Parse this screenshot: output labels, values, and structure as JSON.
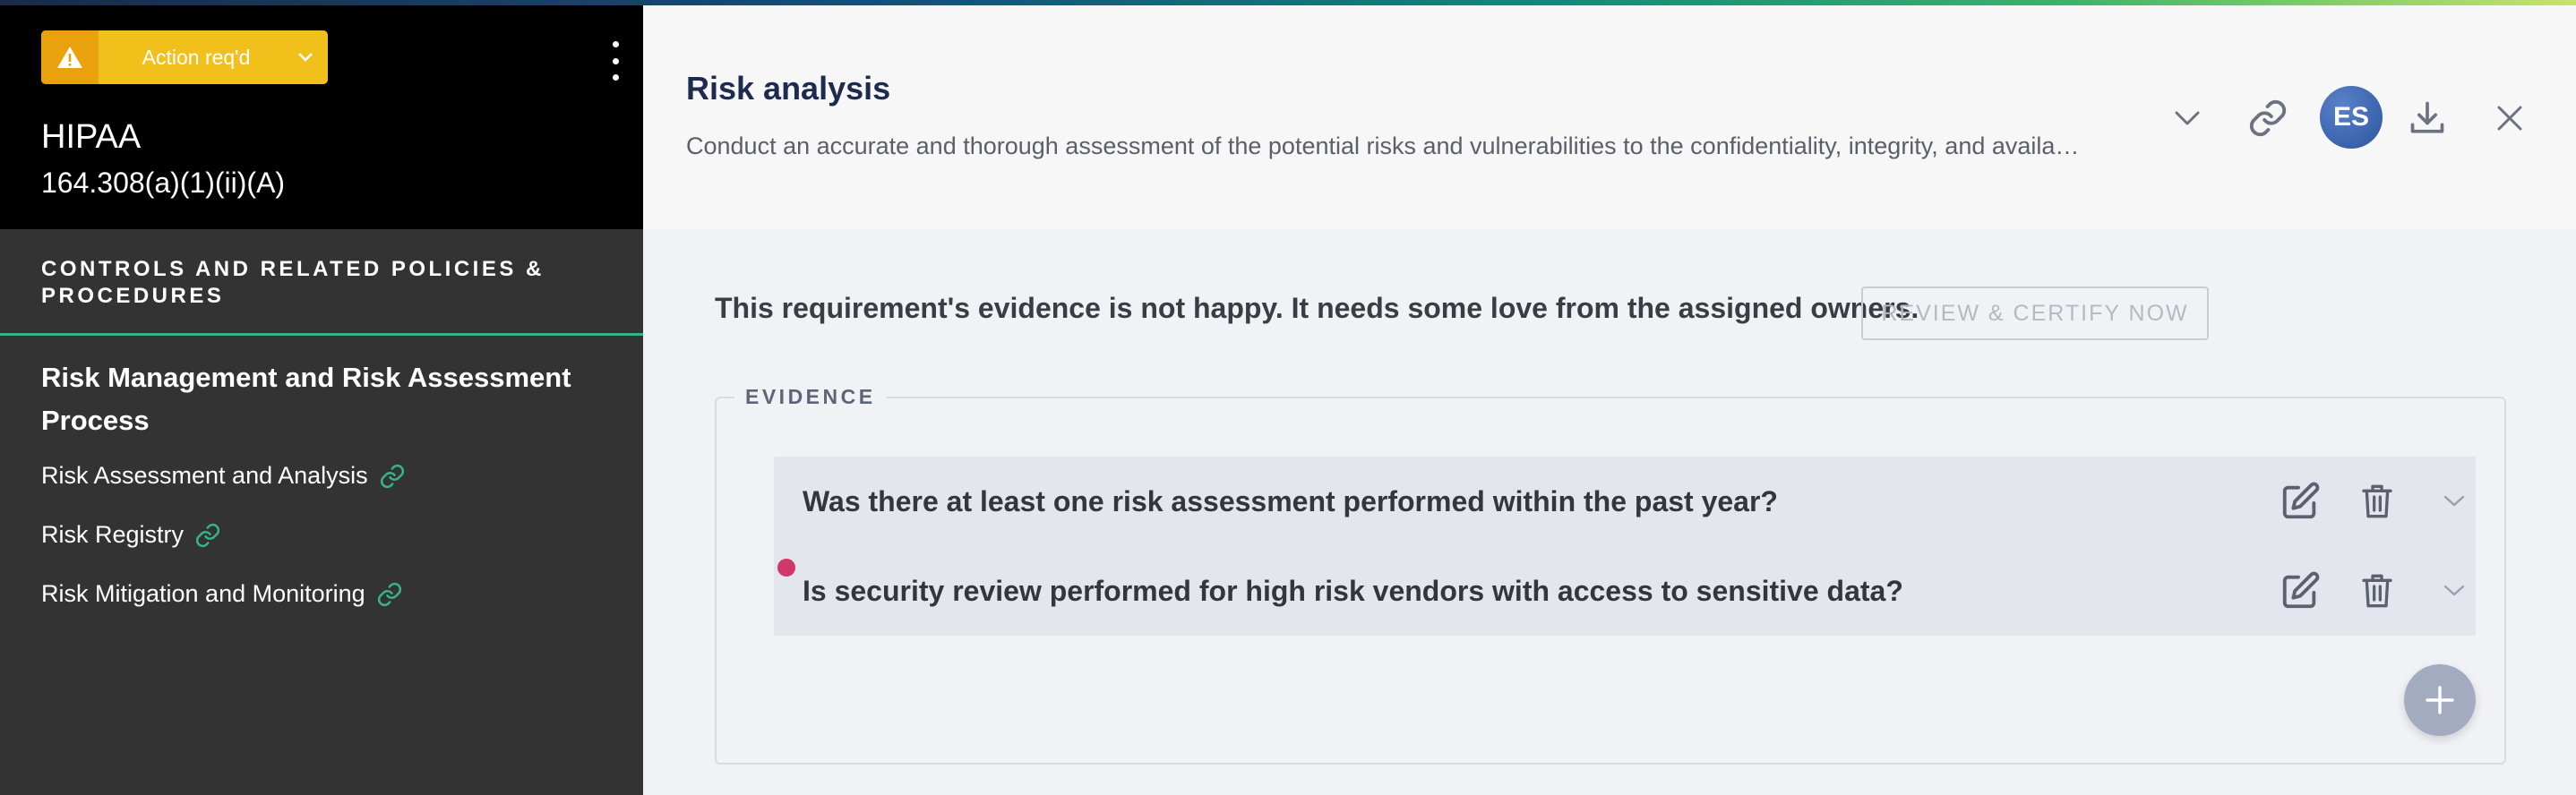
{
  "sidebar": {
    "status_label": "Action req'd",
    "framework": "HIPAA",
    "reference": "164.308(a)(1)(ii)(A)",
    "section_title": "CONTROLS AND RELATED POLICIES & PROCEDURES",
    "group_title": "Risk Management and Risk Assessment Process",
    "items": [
      {
        "label": "Risk Assessment and Analysis",
        "icon": "link-icon"
      },
      {
        "label": "Risk Registry",
        "icon": "link-icon"
      },
      {
        "label": "Risk Mitigation and Monitoring",
        "icon": "link-icon"
      }
    ]
  },
  "header": {
    "title": "Risk analysis",
    "description": "Conduct an accurate and thorough assessment of the potential risks and vulnerabilities to the confidentiality, integrity, and availability of electronic protected health information held by the covered entity.",
    "avatar_initials": "ES"
  },
  "main": {
    "notice": "This requirement's evidence is not happy. It needs some love from the assigned owners.",
    "review_button": "REVIEW & CERTIFY NOW",
    "evidence_label": "EVIDENCE",
    "evidence": [
      {
        "question": "Was there at least one risk assessment performed within the past year?"
      },
      {
        "question": "Is security review performed for high risk vendors with access to sensitive data?"
      }
    ]
  },
  "colors": {
    "status_yellow": "#f2c01b",
    "accent_green": "#34b586",
    "title_navy": "#1c2b4e",
    "alert_dot": "#d0386a",
    "avatar_blue": "#2c55a0"
  }
}
